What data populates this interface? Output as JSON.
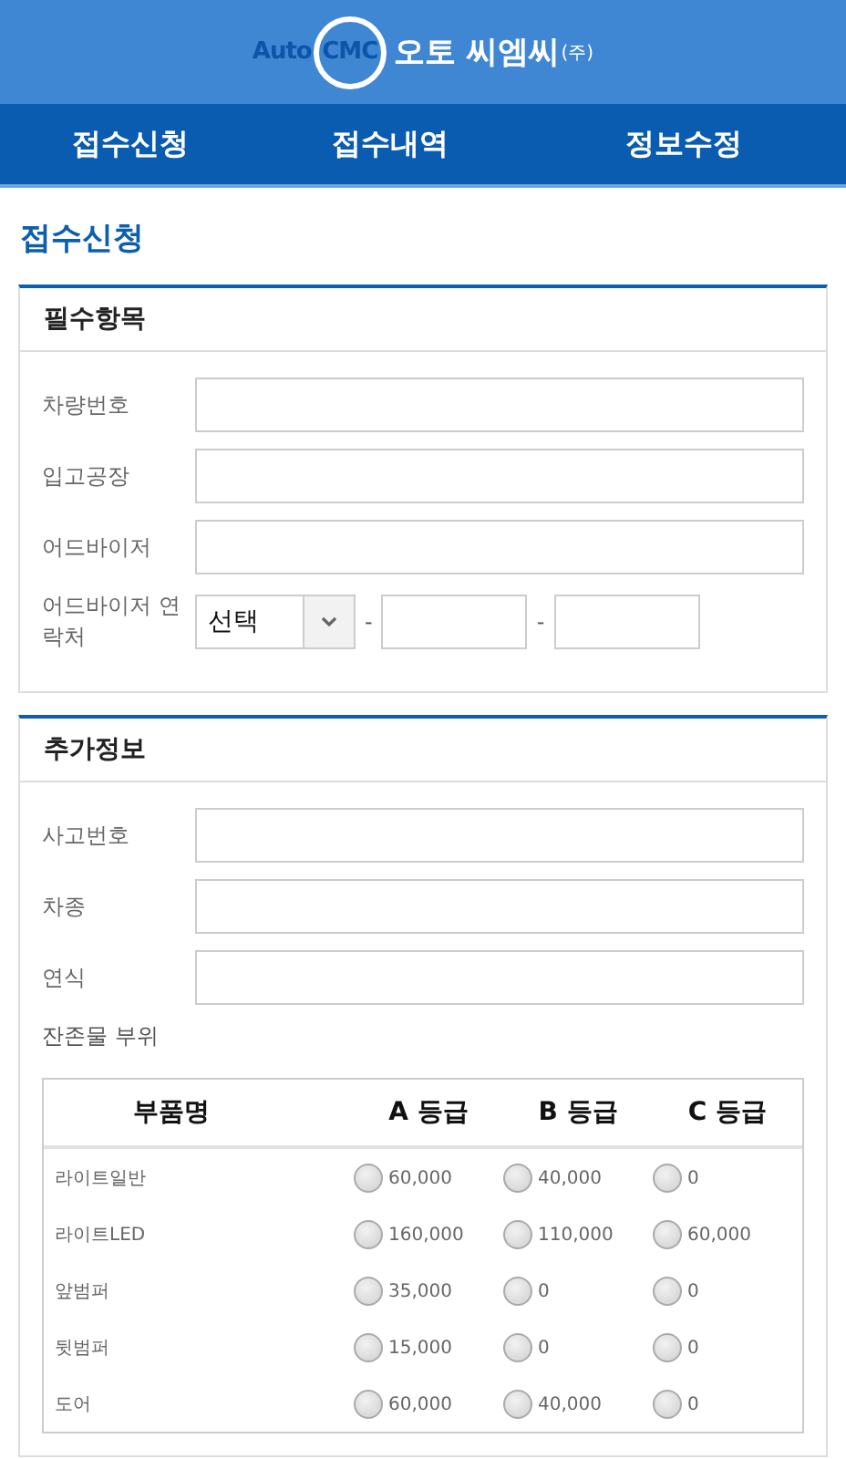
{
  "header": {
    "logo_latin": "Auto",
    "logo_circle": "CMC",
    "logo_korean": "오토 씨엠씨",
    "logo_suffix": "(주)"
  },
  "nav": [
    "접수신청",
    "접수내역",
    "정보수정"
  ],
  "page_title": "접수신청",
  "required_section": {
    "title": "필수항목",
    "fields": [
      {
        "kind": "text",
        "label": "차량번호"
      },
      {
        "kind": "text",
        "label": "입고공장"
      },
      {
        "kind": "text",
        "label": "어드바이저"
      },
      {
        "kind": "phone",
        "label": "어드바이저 연락처",
        "select_value": "선택",
        "separator": "-"
      }
    ]
  },
  "extra_section": {
    "title": "추가정보",
    "fields": [
      {
        "kind": "text",
        "label": "사고번호"
      },
      {
        "kind": "text",
        "label": "차종"
      },
      {
        "kind": "text",
        "label": "연식"
      }
    ],
    "parts_label": "잔존물 부위",
    "table": {
      "columns": [
        "부품명",
        "A 등급",
        "B 등급",
        "C 등급"
      ],
      "rows": [
        {
          "part": "라이트일반",
          "options": [
            {
              "price": "60,000",
              "selected": false
            },
            {
              "price": "40,000",
              "selected": false
            },
            {
              "price": "0",
              "selected": false
            }
          ]
        },
        {
          "part": "라이트LED",
          "options": [
            {
              "price": "160,000",
              "selected": false
            },
            {
              "price": "110,000",
              "selected": false
            },
            {
              "price": "60,000",
              "selected": false
            }
          ]
        },
        {
          "part": "앞범퍼",
          "options": [
            {
              "price": "35,000",
              "selected": false
            },
            {
              "price": "0",
              "selected": false
            },
            {
              "price": "0",
              "selected": false
            }
          ]
        },
        {
          "part": "뒷범퍼",
          "options": [
            {
              "price": "15,000",
              "selected": false
            },
            {
              "price": "0",
              "selected": false
            },
            {
              "price": "0",
              "selected": false
            }
          ]
        },
        {
          "part": "도어",
          "options": [
            {
              "price": "60,000",
              "selected": false
            },
            {
              "price": "40,000",
              "selected": false
            },
            {
              "price": "0",
              "selected": false
            }
          ]
        }
      ]
    }
  }
}
